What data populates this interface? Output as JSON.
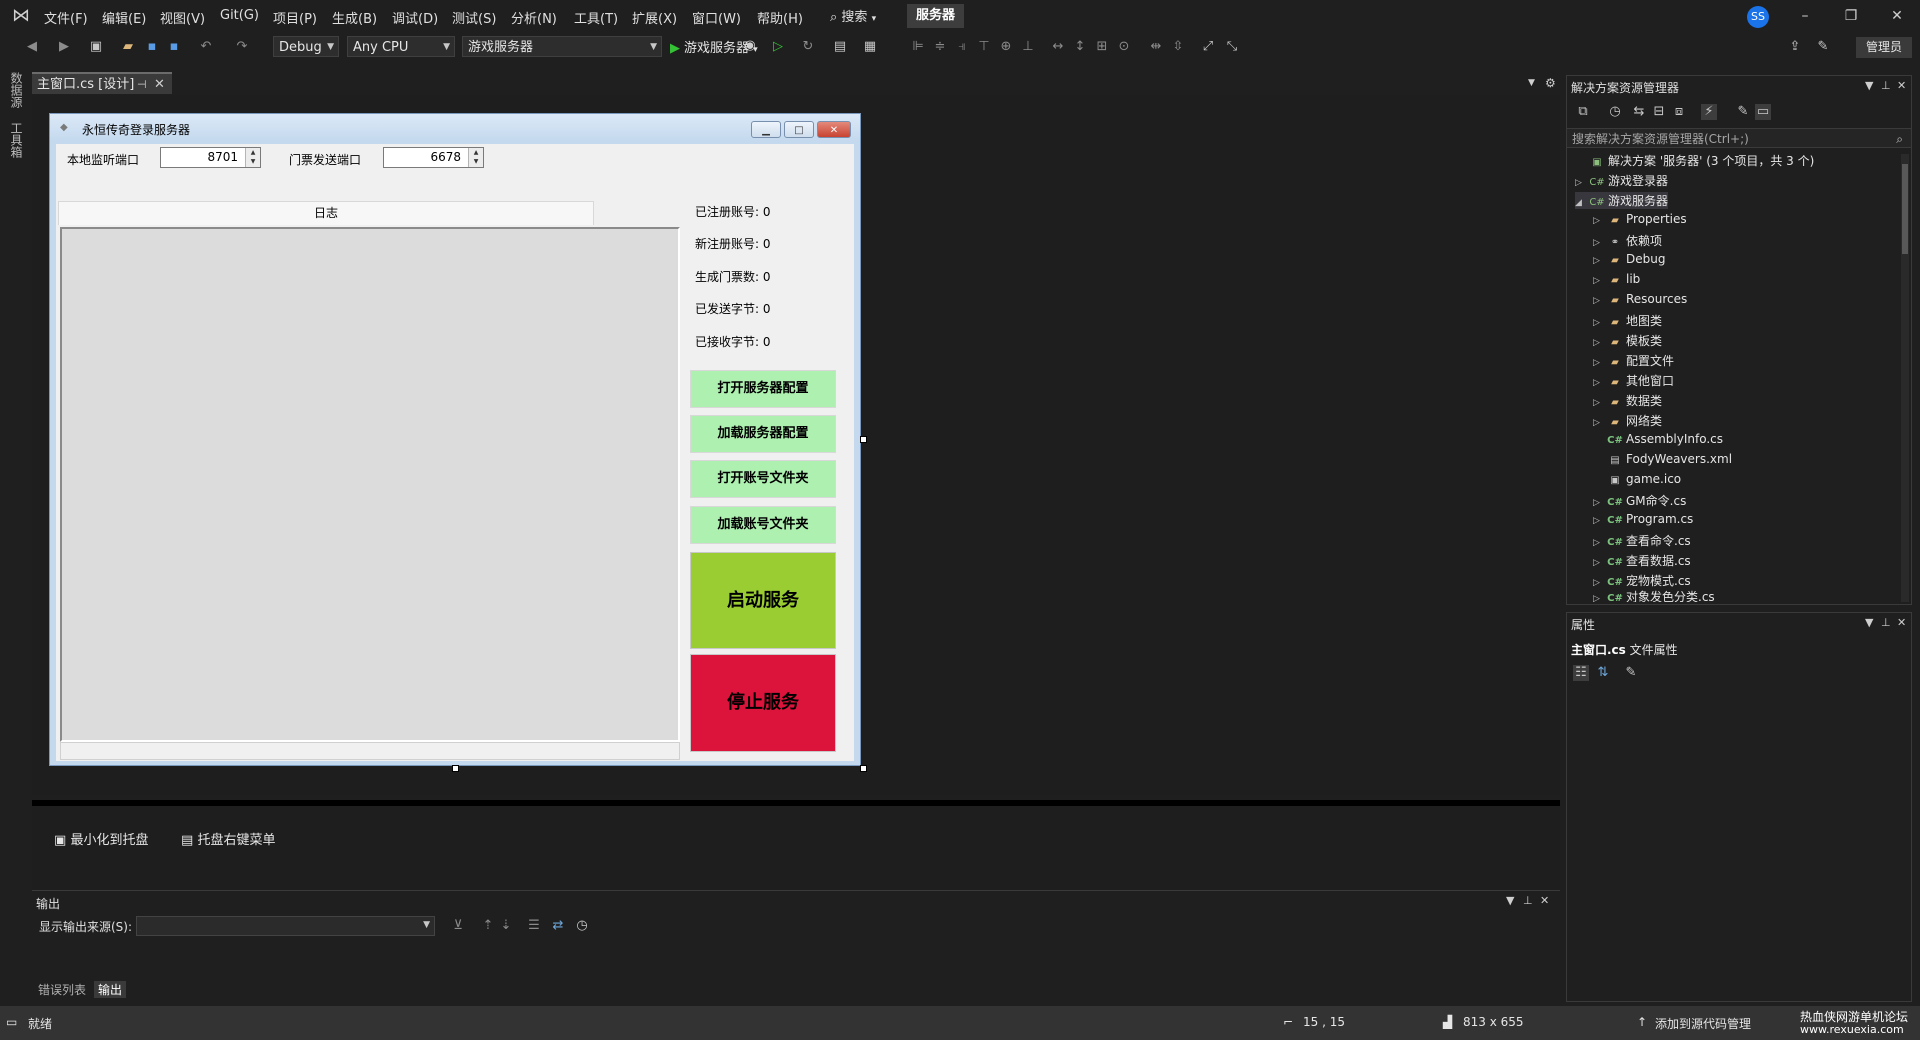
{
  "menu": {
    "items": [
      "文件(F)",
      "编辑(E)",
      "视图(V)",
      "Git(G)",
      "项目(P)",
      "生成(B)",
      "调试(D)",
      "测试(S)",
      "分析(N)",
      "工具(T)",
      "扩展(X)",
      "窗口(W)",
      "帮助(H)"
    ],
    "search": "搜索",
    "solution_name": "服务器",
    "avatar": "SS"
  },
  "toolbar": {
    "config": "Debug",
    "platform": "Any CPU",
    "startup_project": "游戏服务器",
    "run_target": "游戏服务器",
    "admin": "管理员"
  },
  "left_strip": {
    "tab1": "数据源",
    "tab2": "工具箱"
  },
  "doc_tab": {
    "label": "主窗口.cs [设计]"
  },
  "form": {
    "title": "永恒传奇登录服务器",
    "listen_port_label": "本地监听端口",
    "listen_port_value": "8701",
    "ticket_port_label": "门票发送端口",
    "ticket_port_value": "6678",
    "log_tab": "日志",
    "stats": [
      "已注册账号: 0",
      "新注册账号: 0",
      "生成门票数: 0",
      "已发送字节: 0",
      "已接收字节: 0"
    ],
    "buttons": {
      "open_config": "打开服务器配置",
      "load_config": "加载服务器配置",
      "open_accounts": "打开账号文件夹",
      "load_accounts": "加载账号文件夹",
      "start": "启动服务",
      "stop": "停止服务"
    }
  },
  "tray": {
    "minimize": "最小化到托盘",
    "context_menu": "托盘右键菜单"
  },
  "output": {
    "title": "输出",
    "source_label": "显示输出来源(S):"
  },
  "bottom_tabs": {
    "errors": "错误列表",
    "output": "输出"
  },
  "solution_explorer": {
    "title": "解决方案资源管理器",
    "search_placeholder": "搜索解决方案资源管理器(Ctrl+;)",
    "root": "解决方案 '服务器' (3 个项目，共 3 个)",
    "projects": [
      "游戏登录器",
      "游戏服务器"
    ],
    "items": [
      "Properties",
      "依赖项",
      "Debug",
      "lib",
      "Resources",
      "地图类",
      "模板类",
      "配置文件",
      "其他窗口",
      "数据类",
      "网络类",
      "AssemblyInfo.cs",
      "FodyWeavers.xml",
      "game.ico",
      "GM命令.cs",
      "Program.cs",
      "查看命令.cs",
      "查看数据.cs",
      "宠物模式.cs",
      "对象发色分类.cs"
    ]
  },
  "properties": {
    "title": "属性",
    "object_name": "主窗口.cs",
    "object_type": "文件属性"
  },
  "status": {
    "ready": "就绪",
    "position": "15 , 15",
    "size": "813 x 655",
    "source_control": "添加到源代码管理",
    "watermark": "热血侠网游单机论坛",
    "watermark_url": "www.rexuexia.com"
  },
  "colors": {
    "start_button": "#9acd32",
    "stop_button": "#dc143c",
    "green_button": "#adf0b0"
  }
}
